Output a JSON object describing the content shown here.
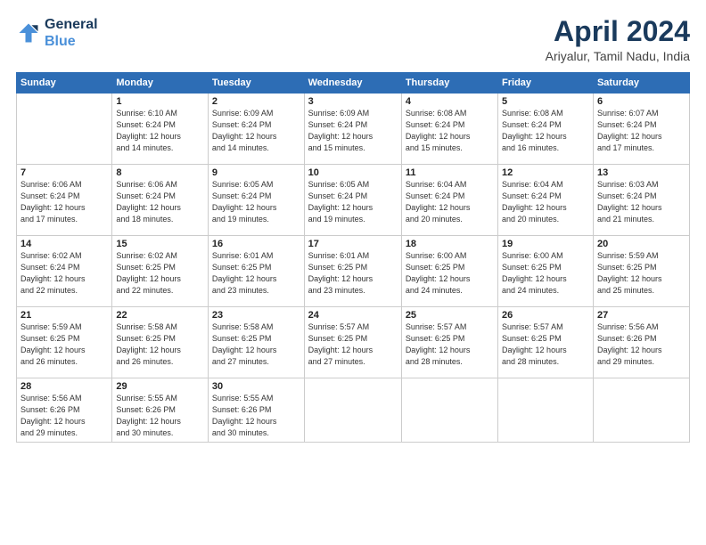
{
  "logo": {
    "line1": "General",
    "line2": "Blue"
  },
  "title": "April 2024",
  "subtitle": "Ariyalur, Tamil Nadu, India",
  "days_of_week": [
    "Sunday",
    "Monday",
    "Tuesday",
    "Wednesday",
    "Thursday",
    "Friday",
    "Saturday"
  ],
  "weeks": [
    [
      {
        "day": "",
        "info": ""
      },
      {
        "day": "1",
        "info": "Sunrise: 6:10 AM\nSunset: 6:24 PM\nDaylight: 12 hours\nand 14 minutes."
      },
      {
        "day": "2",
        "info": "Sunrise: 6:09 AM\nSunset: 6:24 PM\nDaylight: 12 hours\nand 14 minutes."
      },
      {
        "day": "3",
        "info": "Sunrise: 6:09 AM\nSunset: 6:24 PM\nDaylight: 12 hours\nand 15 minutes."
      },
      {
        "day": "4",
        "info": "Sunrise: 6:08 AM\nSunset: 6:24 PM\nDaylight: 12 hours\nand 15 minutes."
      },
      {
        "day": "5",
        "info": "Sunrise: 6:08 AM\nSunset: 6:24 PM\nDaylight: 12 hours\nand 16 minutes."
      },
      {
        "day": "6",
        "info": "Sunrise: 6:07 AM\nSunset: 6:24 PM\nDaylight: 12 hours\nand 17 minutes."
      }
    ],
    [
      {
        "day": "7",
        "info": "Sunrise: 6:06 AM\nSunset: 6:24 PM\nDaylight: 12 hours\nand 17 minutes."
      },
      {
        "day": "8",
        "info": "Sunrise: 6:06 AM\nSunset: 6:24 PM\nDaylight: 12 hours\nand 18 minutes."
      },
      {
        "day": "9",
        "info": "Sunrise: 6:05 AM\nSunset: 6:24 PM\nDaylight: 12 hours\nand 19 minutes."
      },
      {
        "day": "10",
        "info": "Sunrise: 6:05 AM\nSunset: 6:24 PM\nDaylight: 12 hours\nand 19 minutes."
      },
      {
        "day": "11",
        "info": "Sunrise: 6:04 AM\nSunset: 6:24 PM\nDaylight: 12 hours\nand 20 minutes."
      },
      {
        "day": "12",
        "info": "Sunrise: 6:04 AM\nSunset: 6:24 PM\nDaylight: 12 hours\nand 20 minutes."
      },
      {
        "day": "13",
        "info": "Sunrise: 6:03 AM\nSunset: 6:24 PM\nDaylight: 12 hours\nand 21 minutes."
      }
    ],
    [
      {
        "day": "14",
        "info": "Sunrise: 6:02 AM\nSunset: 6:24 PM\nDaylight: 12 hours\nand 22 minutes."
      },
      {
        "day": "15",
        "info": "Sunrise: 6:02 AM\nSunset: 6:25 PM\nDaylight: 12 hours\nand 22 minutes."
      },
      {
        "day": "16",
        "info": "Sunrise: 6:01 AM\nSunset: 6:25 PM\nDaylight: 12 hours\nand 23 minutes."
      },
      {
        "day": "17",
        "info": "Sunrise: 6:01 AM\nSunset: 6:25 PM\nDaylight: 12 hours\nand 23 minutes."
      },
      {
        "day": "18",
        "info": "Sunrise: 6:00 AM\nSunset: 6:25 PM\nDaylight: 12 hours\nand 24 minutes."
      },
      {
        "day": "19",
        "info": "Sunrise: 6:00 AM\nSunset: 6:25 PM\nDaylight: 12 hours\nand 24 minutes."
      },
      {
        "day": "20",
        "info": "Sunrise: 5:59 AM\nSunset: 6:25 PM\nDaylight: 12 hours\nand 25 minutes."
      }
    ],
    [
      {
        "day": "21",
        "info": "Sunrise: 5:59 AM\nSunset: 6:25 PM\nDaylight: 12 hours\nand 26 minutes."
      },
      {
        "day": "22",
        "info": "Sunrise: 5:58 AM\nSunset: 6:25 PM\nDaylight: 12 hours\nand 26 minutes."
      },
      {
        "day": "23",
        "info": "Sunrise: 5:58 AM\nSunset: 6:25 PM\nDaylight: 12 hours\nand 27 minutes."
      },
      {
        "day": "24",
        "info": "Sunrise: 5:57 AM\nSunset: 6:25 PM\nDaylight: 12 hours\nand 27 minutes."
      },
      {
        "day": "25",
        "info": "Sunrise: 5:57 AM\nSunset: 6:25 PM\nDaylight: 12 hours\nand 28 minutes."
      },
      {
        "day": "26",
        "info": "Sunrise: 5:57 AM\nSunset: 6:25 PM\nDaylight: 12 hours\nand 28 minutes."
      },
      {
        "day": "27",
        "info": "Sunrise: 5:56 AM\nSunset: 6:26 PM\nDaylight: 12 hours\nand 29 minutes."
      }
    ],
    [
      {
        "day": "28",
        "info": "Sunrise: 5:56 AM\nSunset: 6:26 PM\nDaylight: 12 hours\nand 29 minutes."
      },
      {
        "day": "29",
        "info": "Sunrise: 5:55 AM\nSunset: 6:26 PM\nDaylight: 12 hours\nand 30 minutes."
      },
      {
        "day": "30",
        "info": "Sunrise: 5:55 AM\nSunset: 6:26 PM\nDaylight: 12 hours\nand 30 minutes."
      },
      {
        "day": "",
        "info": ""
      },
      {
        "day": "",
        "info": ""
      },
      {
        "day": "",
        "info": ""
      },
      {
        "day": "",
        "info": ""
      }
    ]
  ]
}
